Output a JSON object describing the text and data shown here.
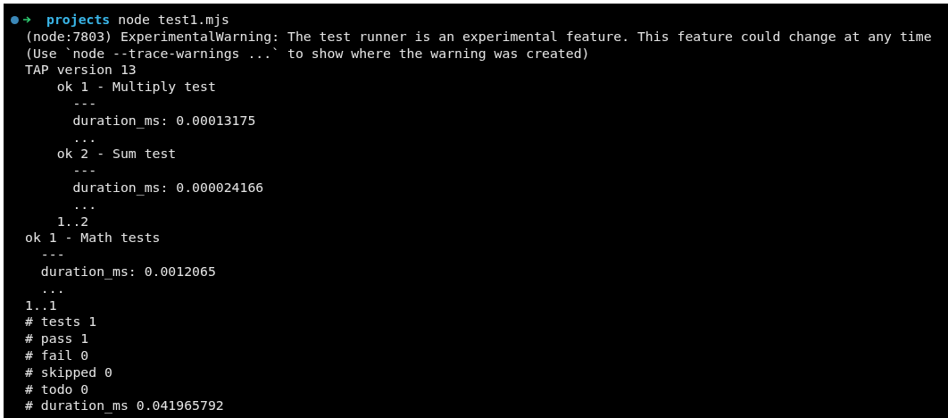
{
  "prompt": {
    "directory": "projects",
    "command": "node test1.mjs"
  },
  "output_lines": [
    "(node:7803) ExperimentalWarning: The test runner is an experimental feature. This feature could change at any time",
    "(Use `node --trace-warnings ...` to show where the warning was created)",
    "TAP version 13",
    "    ok 1 - Multiply test",
    "      ---",
    "      duration_ms: 0.00013175",
    "      ...",
    "    ok 2 - Sum test",
    "      ---",
    "      duration_ms: 0.000024166",
    "      ...",
    "    1..2",
    "ok 1 - Math tests",
    "  ---",
    "  duration_ms: 0.0012065",
    "  ...",
    "1..1",
    "# tests 1",
    "# pass 1",
    "# fail 0",
    "# skipped 0",
    "# todo 0",
    "# duration_ms 0.041965792"
  ]
}
